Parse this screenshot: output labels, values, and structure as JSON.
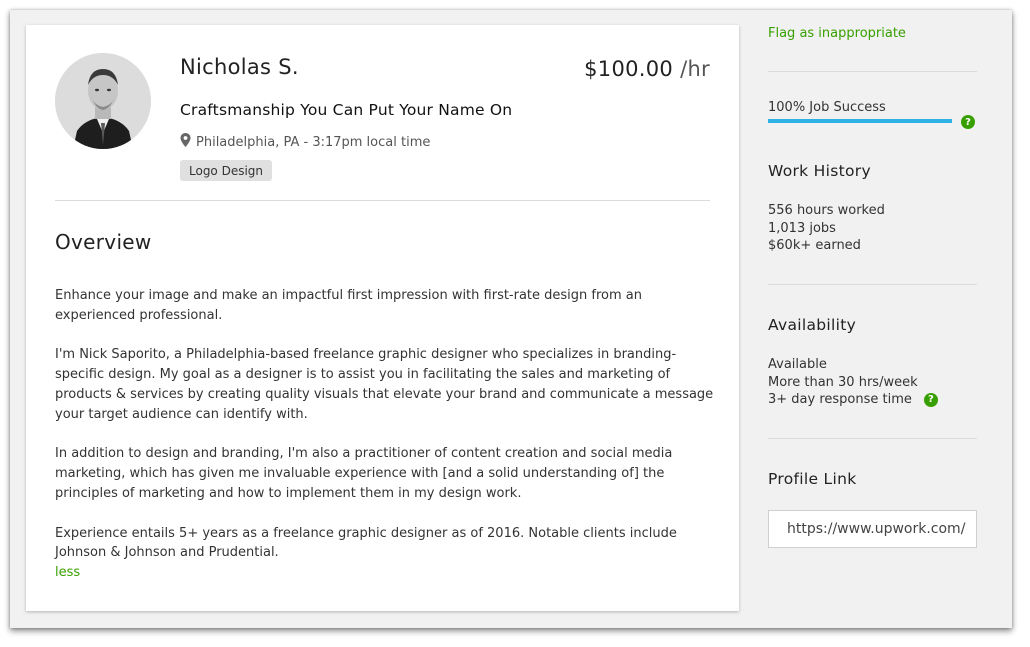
{
  "profile": {
    "name": "Nicholas S.",
    "rate_amount": "$100.00",
    "rate_unit": " /hr",
    "title": "Craftsmanship You Can Put Your Name On",
    "location": "Philadelphia, PA - 3:17pm local time",
    "skills": [
      "Logo Design"
    ]
  },
  "overview": {
    "heading": "Overview",
    "paragraphs": [
      "Enhance your image and make an impactful first impression with first-rate design from an experienced professional.",
      "I'm Nick Saporito, a Philadelphia-based freelance graphic designer who specializes in branding-specific design. My goal as a designer is to assist you in facilitating the sales and marketing of products & services by creating quality visuals that elevate your brand and communicate a message your target audience can identify with.",
      "In addition to design and branding, I'm also a practitioner of content creation and social media marketing, which has given me invaluable experience with [and a solid understanding of] the principles of marketing and how to implement them in my design work.",
      "Experience entails 5+ years as a freelance graphic designer as of 2016. Notable clients include Johnson & Johnson and Prudential."
    ],
    "less_label": "less"
  },
  "sidebar": {
    "flag_label": "Flag as inappropriate",
    "job_success_label": "100% Job Success",
    "job_success_fraction": 1.0,
    "work_history": {
      "heading": "Work History",
      "lines": [
        "556 hours worked",
        "1,013 jobs",
        "$60k+ earned"
      ]
    },
    "availability": {
      "heading": "Availability",
      "lines": [
        "Available",
        "More than 30 hrs/week",
        "3+ day response time"
      ]
    },
    "profile_link": {
      "heading": "Profile Link",
      "value": "https://www.upwork.com/o/profiles/users/"
    }
  },
  "colors": {
    "accent_green": "#37a000",
    "progress_blue": "#30b1e5"
  },
  "icons": {
    "location": "map-pin-icon",
    "help": "question-circle-icon"
  }
}
